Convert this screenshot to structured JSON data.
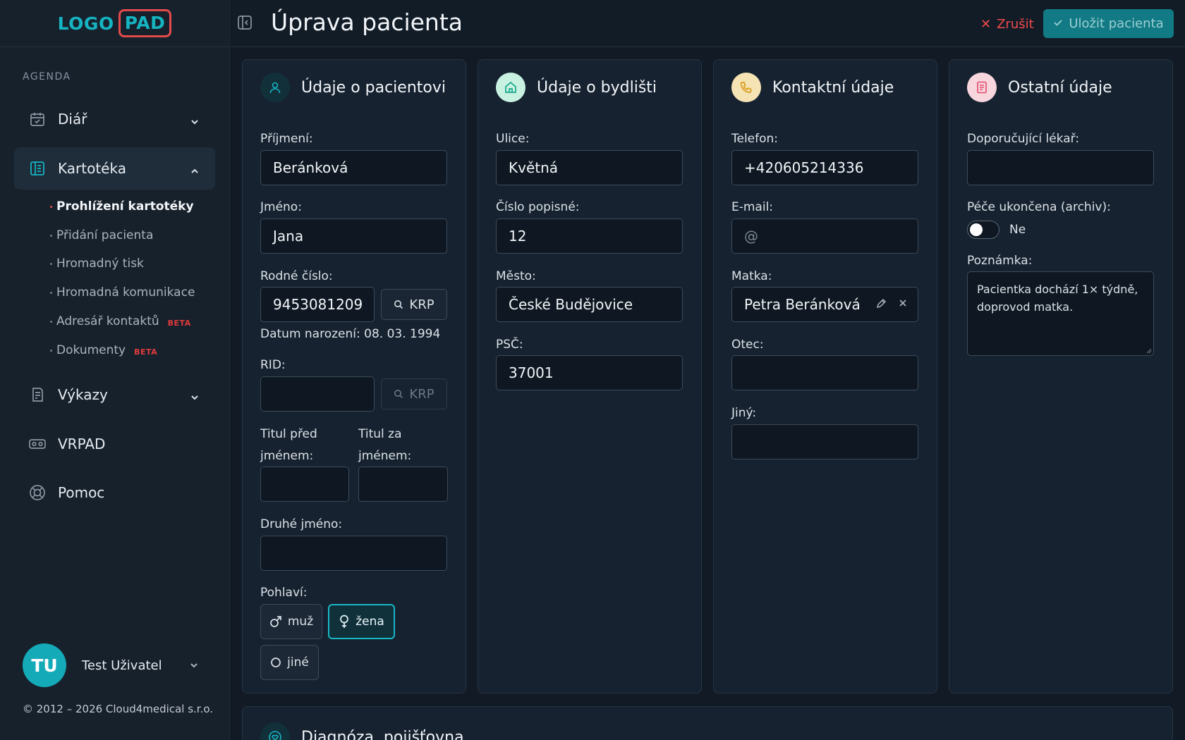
{
  "logo": {
    "part1": "LOGO",
    "part2": "PAD"
  },
  "sidebar": {
    "section": "AGENDA",
    "items": [
      {
        "label": "Diář"
      },
      {
        "label": "Kartotéka"
      },
      {
        "label": "Výkazy"
      },
      {
        "label": "VRPAD"
      },
      {
        "label": "Pomoc"
      }
    ],
    "subitems": [
      {
        "label": "Prohlížení kartotéky"
      },
      {
        "label": "Přidání pacienta"
      },
      {
        "label": "Hromadný tisk"
      },
      {
        "label": "Hromadná komunikace"
      },
      {
        "label": "Adresář kontaktů",
        "badge": "BETA"
      },
      {
        "label": "Dokumenty",
        "badge": "BETA"
      }
    ],
    "user": {
      "initials": "TU",
      "name": "Test Uživatel"
    },
    "copyright": "© 2012 – 2026 Cloud4medical s.r.o."
  },
  "header": {
    "title": "Úprava pacienta",
    "cancel_label": "Zrušit",
    "save_label": "Uložit pacienta"
  },
  "patient": {
    "title": "Údaje o pacientovi",
    "surname_label": "Příjmení:",
    "surname": "Beránková",
    "name_label": "Jméno:",
    "name": "Jana",
    "birth_number_label": "Rodné číslo:",
    "birth_number": "9453081209",
    "krp_label": "KRP",
    "birth_date": "Datum narození: 08. 03. 1994",
    "rid_label": "RID:",
    "rid": "",
    "title_before_label_1": "Titul před",
    "title_before_label_2": "jménem:",
    "title_after_label_1": "Titul za",
    "title_after_label_2": "jménem:",
    "middle_name_label": "Druhé jméno:",
    "gender_label": "Pohlaví:",
    "gender_options": [
      "muž",
      "žena",
      "jiné"
    ],
    "gender_selected": "žena"
  },
  "address": {
    "title": "Údaje o bydlišti",
    "street_label": "Ulice:",
    "street": "Květná",
    "number_label": "Číslo popisné:",
    "number": "12",
    "city_label": "Město:",
    "city": "České Budějovice",
    "zip_label": "PSČ:",
    "zip": "37001"
  },
  "contact": {
    "title": "Kontaktní údaje",
    "phone_label": "Telefon:",
    "phone": "+420605214336",
    "email_label": "E-mail:",
    "email_placeholder": "@",
    "mother_label": "Matka:",
    "mother": "Petra Beránková",
    "father_label": "Otec:",
    "other_label": "Jiný:"
  },
  "other": {
    "title": "Ostatní údaje",
    "doctor_label": "Doporučující lékař:",
    "archive_label": "Péče ukončena (archiv):",
    "archive_value": "Ne",
    "note_label": "Poznámka:",
    "note": "Pacientka dochází 1× týdně, doprovod matka."
  },
  "bottom": {
    "title": "Diagnóza, pojišťovna"
  },
  "colors": {
    "accent": "#16b3c1",
    "danger": "#ef4b4b",
    "save": "#127a84"
  }
}
